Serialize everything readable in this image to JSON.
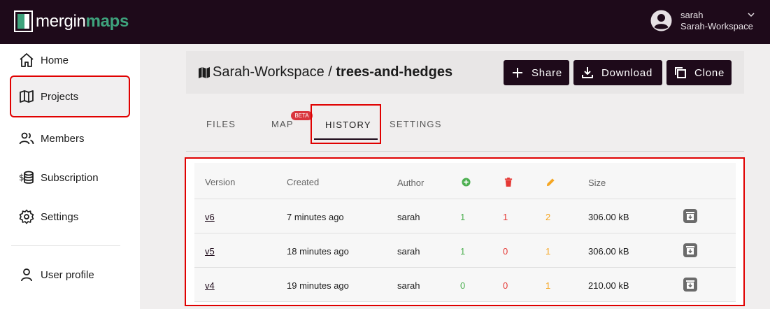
{
  "app": {
    "logo_part1": "mergin",
    "logo_part2": "maps"
  },
  "user": {
    "name": "sarah",
    "workspace": "Sarah-Workspace"
  },
  "sidebar": {
    "items": [
      {
        "label": "Home",
        "icon": "home-icon"
      },
      {
        "label": "Projects",
        "icon": "map-icon",
        "active": true
      },
      {
        "label": "Members",
        "icon": "users-icon"
      },
      {
        "label": "Subscription",
        "icon": "coins-icon"
      },
      {
        "label": "Settings",
        "icon": "gear-icon"
      },
      {
        "label": "User profile",
        "icon": "user-icon"
      }
    ]
  },
  "header": {
    "workspace": "Sarah-Workspace",
    "separator": " / ",
    "project": "trees-and-hedges",
    "share_label": "Share",
    "download_label": "Download",
    "clone_label": "Clone"
  },
  "tabs": {
    "files": "FILES",
    "map": "MAP",
    "beta": "BETA",
    "history": "HISTORY",
    "settings": "SETTINGS"
  },
  "table": {
    "headers": {
      "version": "Version",
      "created": "Created",
      "author": "Author",
      "size": "Size"
    },
    "rows": [
      {
        "version": "v6",
        "created": "7 minutes ago",
        "author": "sarah",
        "added": "1",
        "removed": "1",
        "updated": "2",
        "size": "306.00 kB"
      },
      {
        "version": "v5",
        "created": "18 minutes ago",
        "author": "sarah",
        "added": "1",
        "removed": "0",
        "updated": "1",
        "size": "306.00 kB"
      },
      {
        "version": "v4",
        "created": "19 minutes ago",
        "author": "sarah",
        "added": "0",
        "removed": "0",
        "updated": "1",
        "size": "210.00 kB"
      }
    ]
  },
  "colors": {
    "topbar": "#1e0a1a",
    "brand_green": "#3ea27c",
    "added": "#4caf50",
    "removed": "#e53935",
    "updated": "#f5a623"
  }
}
